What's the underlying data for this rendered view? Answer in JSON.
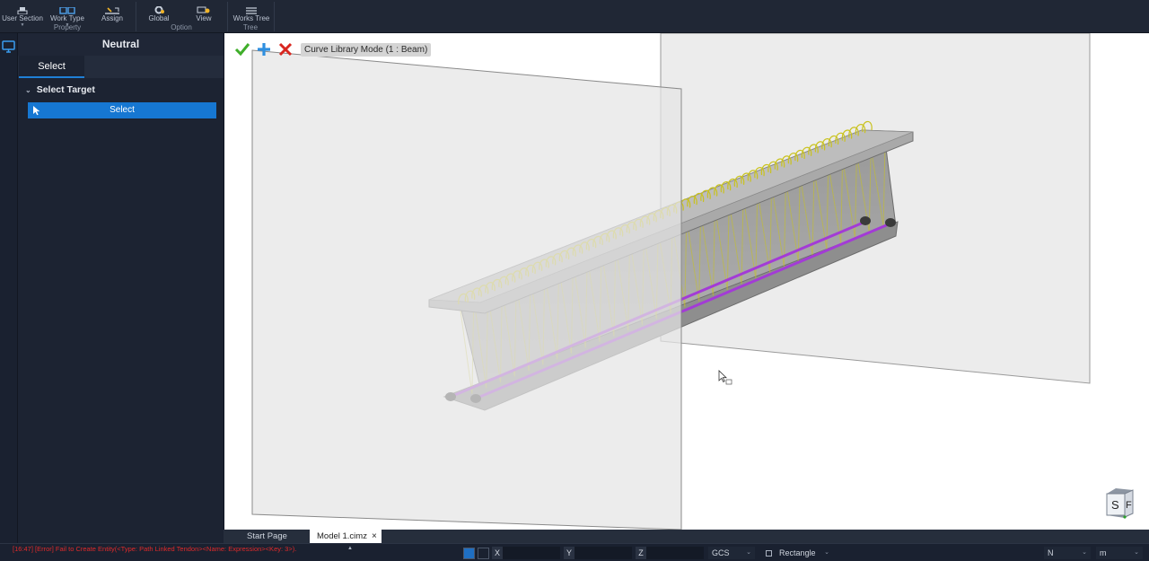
{
  "ribbon": {
    "buttons": [
      {
        "label": "User Section",
        "icon": "user-section-icon",
        "has_dropdown": true
      },
      {
        "label": "Work Type",
        "icon": "work-type-icon",
        "has_dropdown": true
      },
      {
        "label": "Assign",
        "icon": "assign-icon",
        "has_dropdown": false
      },
      {
        "label": "Global",
        "icon": "gear-icon",
        "has_dropdown": false
      },
      {
        "label": "View",
        "icon": "view-settings-icon",
        "has_dropdown": false
      },
      {
        "label": "Works Tree",
        "icon": "works-tree-icon",
        "has_dropdown": false
      }
    ],
    "groups": [
      "Property",
      "Option",
      "Tree"
    ]
  },
  "panel": {
    "title": "Neutral",
    "tab": "Select",
    "section": "Select Target",
    "select_button": "Select"
  },
  "viewport": {
    "mode_label": "Curve Library Mode (1 : Beam)",
    "confirm_icon": "checkmark-icon",
    "add_icon": "plus-icon",
    "cancel_icon": "close-icon",
    "view_cube_letters": [
      "S",
      "F"
    ]
  },
  "doc_tabs": [
    {
      "label": "Start Page",
      "active": false
    },
    {
      "label": "Model 1.cimz",
      "active": true
    }
  ],
  "status": {
    "error": "[16:47] [Error] Fail to Create Entity(<Type: Path Linked Tendon><Name: Expression><Key: 3>).",
    "x_label": "X",
    "y_label": "Y",
    "z_label": "Z",
    "x_value": "",
    "y_value": "",
    "z_value": "",
    "coord_system": "GCS",
    "select_shape": "Rectangle",
    "force_unit": "N",
    "length_unit": "m"
  },
  "colors": {
    "accent": "#1677d2",
    "panel_bg": "#1c2332",
    "error": "#e02a2a",
    "tendon": "#a33bd6",
    "stirrup": "#c9c21e",
    "confirm": "#3fae2a",
    "cancel": "#d8261f"
  }
}
